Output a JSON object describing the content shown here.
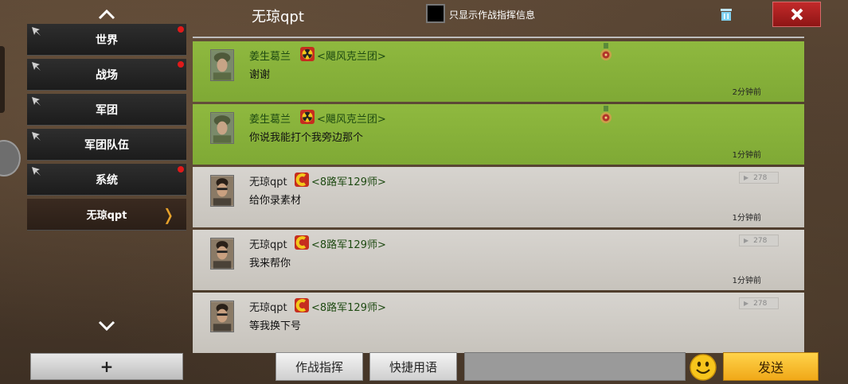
{
  "sidebar": {
    "items": [
      {
        "label": "世界",
        "unread": true
      },
      {
        "label": "战场",
        "unread": true
      },
      {
        "label": "军团",
        "unread": false
      },
      {
        "label": "军团队伍",
        "unread": false
      },
      {
        "label": "系统",
        "unread": true
      },
      {
        "label": "无琼qpt",
        "unread": false,
        "active": true
      }
    ],
    "add_label": "+"
  },
  "header": {
    "title": "无琼qpt",
    "filter_label": "只显示作战指挥信息"
  },
  "messages": [
    {
      "sender": "姜生葛兰",
      "clan": "<飓风克兰团>",
      "text": "谢谢",
      "time": "2分钟前",
      "style": "green",
      "emblem": "radiation-emblem",
      "badge": "medal-icon"
    },
    {
      "sender": "姜生葛兰",
      "clan": "<飓风克兰团>",
      "text": "你说我能打个我旁边那个",
      "time": "1分钟前",
      "style": "green",
      "emblem": "radiation-emblem",
      "badge": "medal-icon"
    },
    {
      "sender": "无琼qpt",
      "clan": "<8路军129师>",
      "text": "给你录素材",
      "time": "1分钟前",
      "style": "gray",
      "emblem": "c-emblem",
      "badge_value": "278"
    },
    {
      "sender": "无琼qpt",
      "clan": "<8路军129师>",
      "text": "我来帮你",
      "time": "1分钟前",
      "style": "gray",
      "emblem": "c-emblem",
      "badge_value": "278"
    },
    {
      "sender": "无琼qpt",
      "clan": "<8路军129师>",
      "text": "等我换下号",
      "time": "",
      "style": "gray",
      "emblem": "c-emblem",
      "badge_value": "278"
    }
  ],
  "bottom": {
    "command_label": "作战指挥",
    "quick_label": "快捷用语",
    "send_label": "发送",
    "input_value": ""
  },
  "colors": {
    "green_message": "#8fb93f",
    "gray_message": "#d7d4cf",
    "send_button": "#f0a818",
    "close_button": "#b22222",
    "unread_dot": "#e01a1a"
  }
}
